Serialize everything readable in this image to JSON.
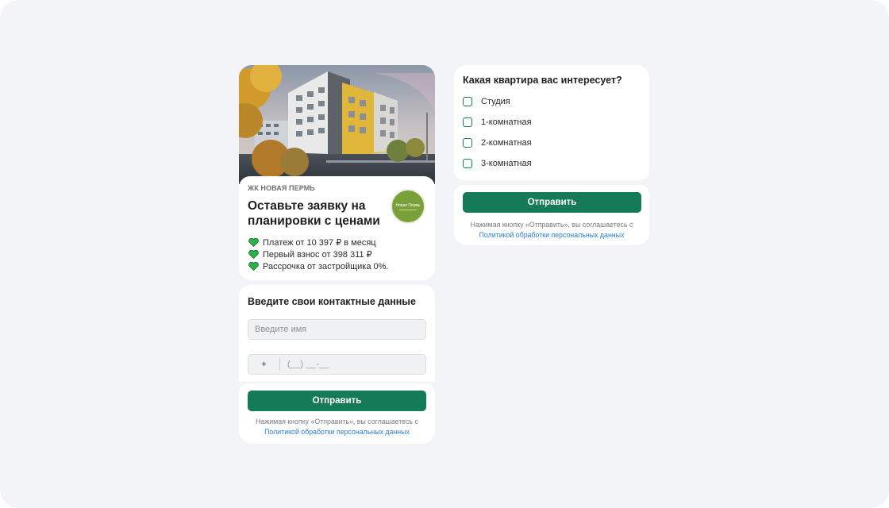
{
  "hero": {
    "project_tag": "ЖК НОВАЯ ПЕРМЬ",
    "headline": "Оставьте заявку на планировки с ценами",
    "logo_text": "Новая Пермь",
    "benefits": [
      "Платеж от 10 397 ₽ в месяц",
      "Первый взнос от 398 311 ₽",
      "Рассрочка от застройщика 0%."
    ]
  },
  "contact": {
    "title": "Введите свои контактные данные",
    "name_placeholder": "Введите имя",
    "phone_code": "+",
    "phone_mask": "(__) __-__"
  },
  "submit_left": {
    "button_label": "Отправить",
    "consent_text": "Нажимая кнопку «Отправить», вы соглашаетесь с",
    "policy_link": "Политикой обработки персональных данных"
  },
  "quiz": {
    "question": "Какая квартира вас интересует?",
    "options": [
      "Студия",
      "1-комнатная",
      "2-комнатная",
      "3-комнатная"
    ]
  },
  "submit_right": {
    "button_label": "Отправить",
    "consent_text": "Нажимая кнопку «Отправить», вы соглашаетесь с",
    "policy_link": "Политикой обработки персональных данных"
  },
  "colors": {
    "accent_green": "#157a57",
    "heart_green": "#2bb24a",
    "link_blue": "#2a7fd0",
    "page_bg": "#f3f4f7"
  },
  "icons": [
    "heart-icon",
    "checkbox-icon",
    "logo-badge"
  ]
}
